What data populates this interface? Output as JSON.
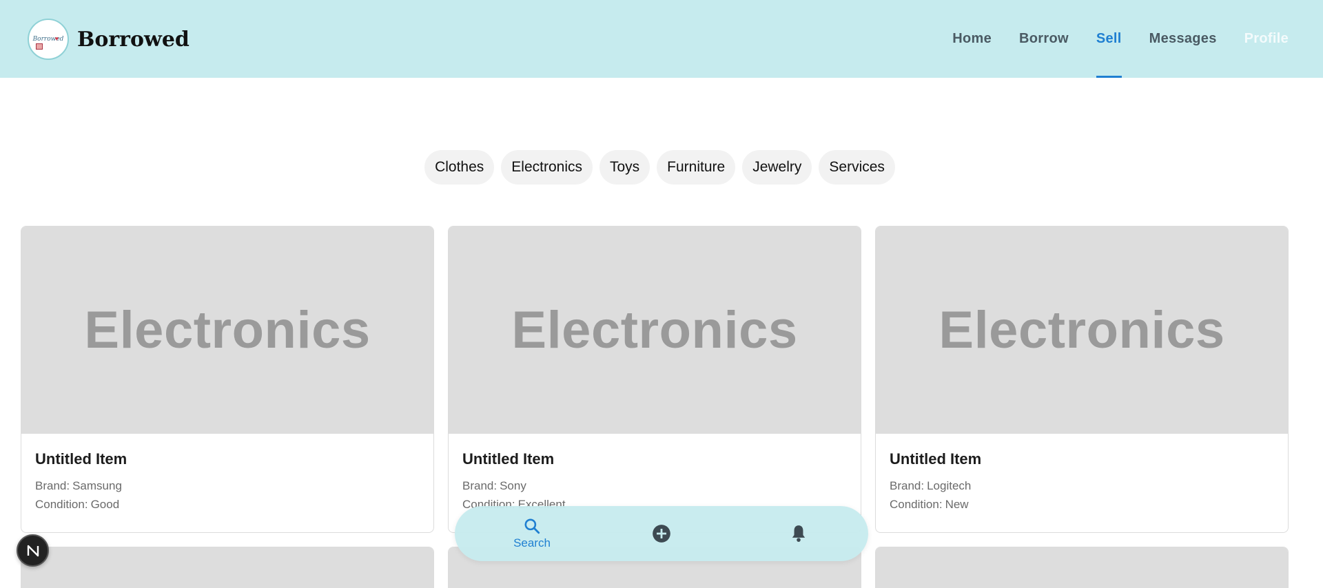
{
  "brand": {
    "name": "Borrowed",
    "logo_script": "Borrowed"
  },
  "nav": [
    {
      "label": "Home"
    },
    {
      "label": "Borrow"
    },
    {
      "label": "Sell"
    },
    {
      "label": "Messages"
    },
    {
      "label": "Profile"
    }
  ],
  "categories": [
    "Clothes",
    "Electronics",
    "Toys",
    "Furniture",
    "Jewelry",
    "Services"
  ],
  "items": [
    {
      "image_text": "Electronics",
      "title": "Untitled Item",
      "brand_label": "Brand:",
      "brand": "Samsung",
      "condition_label": "Condition:",
      "condition": "Good"
    },
    {
      "image_text": "Electronics",
      "title": "Untitled Item",
      "brand_label": "Brand:",
      "brand": "Sony",
      "condition_label": "Condition:",
      "condition": "Excellent"
    },
    {
      "image_text": "Electronics",
      "title": "Untitled Item",
      "brand_label": "Brand:",
      "brand": "Logitech",
      "condition_label": "Condition:",
      "condition": "New"
    }
  ],
  "bottom_nav": {
    "search_label": "Search"
  },
  "fab": {
    "icon_text": "N"
  },
  "colors": {
    "header": "#c6ebee",
    "accent": "#1f7fd1",
    "placeholder": "#dddddd"
  }
}
